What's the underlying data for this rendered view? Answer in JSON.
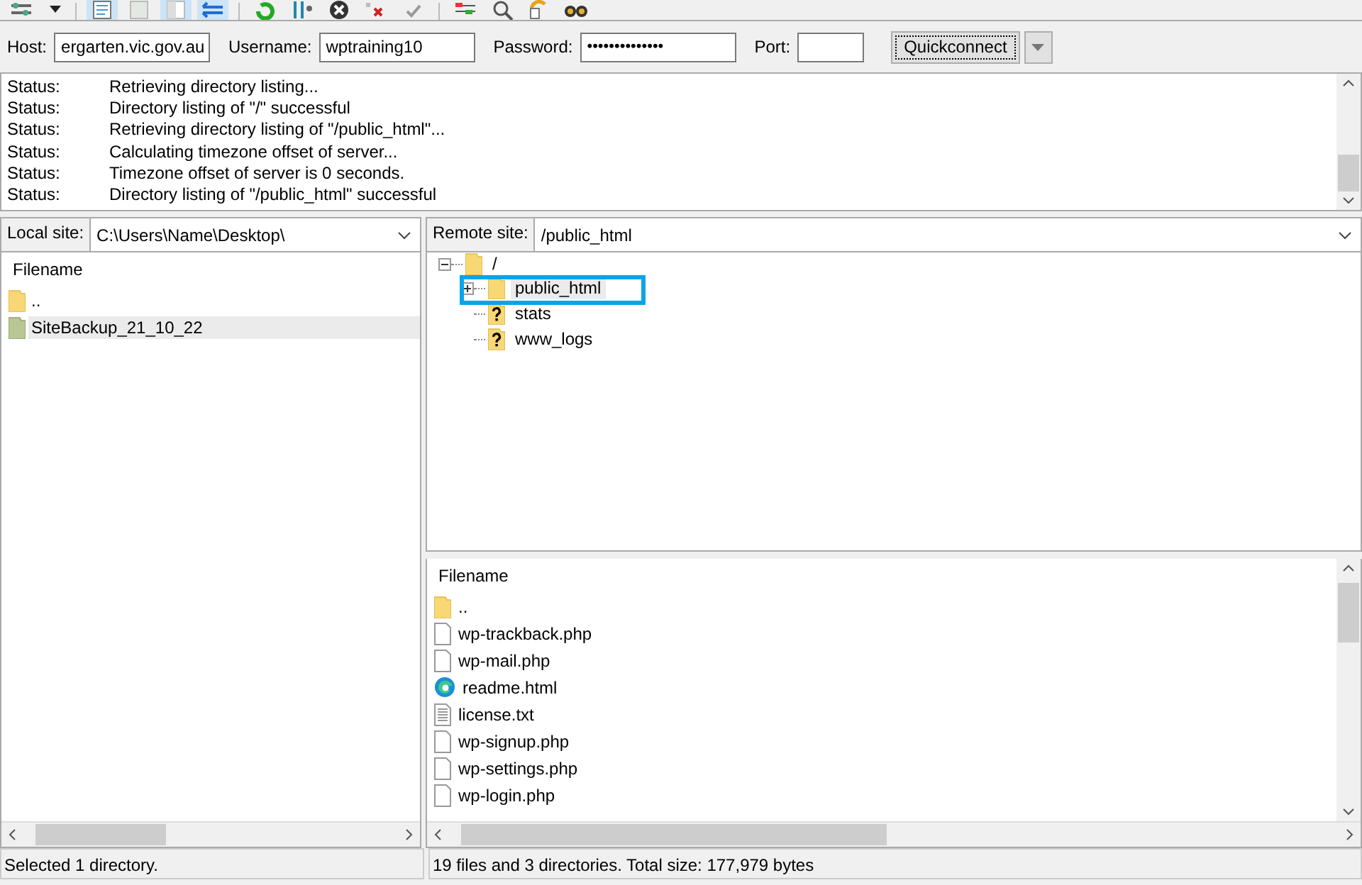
{
  "quickconnect": {
    "fields": [
      {
        "label": "Host:",
        "value": "ergarten.vic.gov.au",
        "kind": "text"
      },
      {
        "label": "Username:",
        "value": "wptraining10",
        "kind": "text"
      },
      {
        "label": "Password:",
        "value": "••••••••••••••",
        "kind": "password"
      },
      {
        "label": "Port:",
        "kind": "port"
      }
    ],
    "button": "Quickconnect"
  },
  "log": [
    {
      "label": "Status:",
      "message": "Retrieving directory listing..."
    },
    {
      "label": "Status:",
      "message": "Directory listing of \"/\" successful"
    },
    {
      "label": "Status:",
      "message": "Retrieving directory listing of \"/public_html\"..."
    },
    {
      "label": "Status:",
      "message": "Calculating timezone offset of server..."
    },
    {
      "label": "Status:",
      "message": "Timezone offset of server is 0 seconds."
    },
    {
      "label": "Status:",
      "message": "Directory listing of \"/public_html\" successful"
    }
  ],
  "local": {
    "site_label": "Local site:",
    "path": "C:\\Users\\Name\\Desktop\\",
    "column": "Filename",
    "files": [
      {
        "name": "..",
        "kind": "folder",
        "selected": false
      },
      {
        "name": "SiteBackup_21_10_22",
        "kind": "archive",
        "selected": true
      }
    ],
    "status": "Selected 1 directory."
  },
  "remote": {
    "site_label": "Remote site:",
    "path": "/public_html",
    "tree": [
      {
        "name": "/",
        "kind": "folder",
        "expanded": true,
        "children": [
          {
            "name": "public_html",
            "kind": "folder",
            "selected": true,
            "expanded": false
          },
          {
            "name": "stats",
            "kind": "unknown",
            "selected": false
          },
          {
            "name": "www_logs",
            "kind": "unknown",
            "selected": false
          }
        ]
      }
    ],
    "column": "Filename",
    "files": [
      {
        "name": "..",
        "kind": "folder"
      },
      {
        "name": "wp-trackback.php",
        "kind": "file"
      },
      {
        "name": "wp-mail.php",
        "kind": "file"
      },
      {
        "name": "readme.html",
        "kind": "web"
      },
      {
        "name": "license.txt",
        "kind": "text"
      },
      {
        "name": "wp-signup.php",
        "kind": "file"
      },
      {
        "name": "wp-settings.php",
        "kind": "file"
      },
      {
        "name": "wp-login.php",
        "kind": "file"
      }
    ],
    "status": "19 files and 3 directories. Total size: 177,979 bytes"
  }
}
